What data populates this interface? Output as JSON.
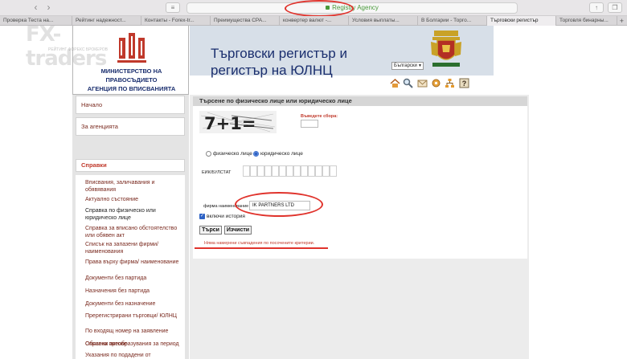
{
  "browser": {
    "address": "Registry Agency",
    "tabs": [
      "Проверка Теста на...",
      "Рейтинг надежност...",
      "Контакты - Forex-tr...",
      "Преимущества CPA...",
      "конвертер валют -...",
      "Условия выплаты...",
      "В Болгарии - Торго...",
      "Търговски регистър",
      "Торговля бинарны..."
    ]
  },
  "watermark": {
    "main": "FX-traders",
    "sub": "РЕЙТИНГ ФОРЕКС БРОКЕРОВ"
  },
  "header": {
    "ministry_line1": "МИНИСТЕРСТВО НА ПРАВОСЪДИЕТО",
    "ministry_line2": "АГЕНЦИЯ ПО ВПИСВАНИЯТА",
    "title_line1": "Търговски регистър и",
    "title_line2": "регистър на ЮЛНЦ",
    "language": "Български"
  },
  "sidebar": {
    "home": "Начало",
    "about": "За агенцията",
    "section": "Справки",
    "items": [
      "Вписвания, заличавания и обявявания",
      "Актуално състояние",
      "Справка по физическо или юридическо лице",
      "Справка за вписано обстоятелство или обявен акт",
      "Списък на запазени фирми/ наименования",
      "Права върху фирма/ наименование",
      "Документи без партида",
      "Назначения без партида",
      "Документи без назначение",
      "Пререгистрирани търговци/ ЮЛНЦ",
      "По входящ номер на заявление",
      "Справка преобразувания за период",
      "Обявени актове",
      "Указания по подадени от нерегистрирани търговци/ЮЛНЦ заявления"
    ]
  },
  "form": {
    "heading": "Търсене по физическо лице или юридическо лице",
    "captcha_text": "7+1=",
    "captcha_label": "Въведете сбора:",
    "radio_person": "физическо лице",
    "radio_legal": "юридическо лице",
    "selected_radio": "legal",
    "eik_label": "ЕИК/БУЛСТАТ",
    "firm_label": "фирма наименование",
    "firm_value": "IK PARTNERS LTD",
    "history_label": "включи история",
    "history_checked": true,
    "search_button": "Търси",
    "clear_button": "Изчисти",
    "result_message": "Няма намерени съвпадения по посочените критерии.",
    "highlight_color": "#e0332c"
  }
}
